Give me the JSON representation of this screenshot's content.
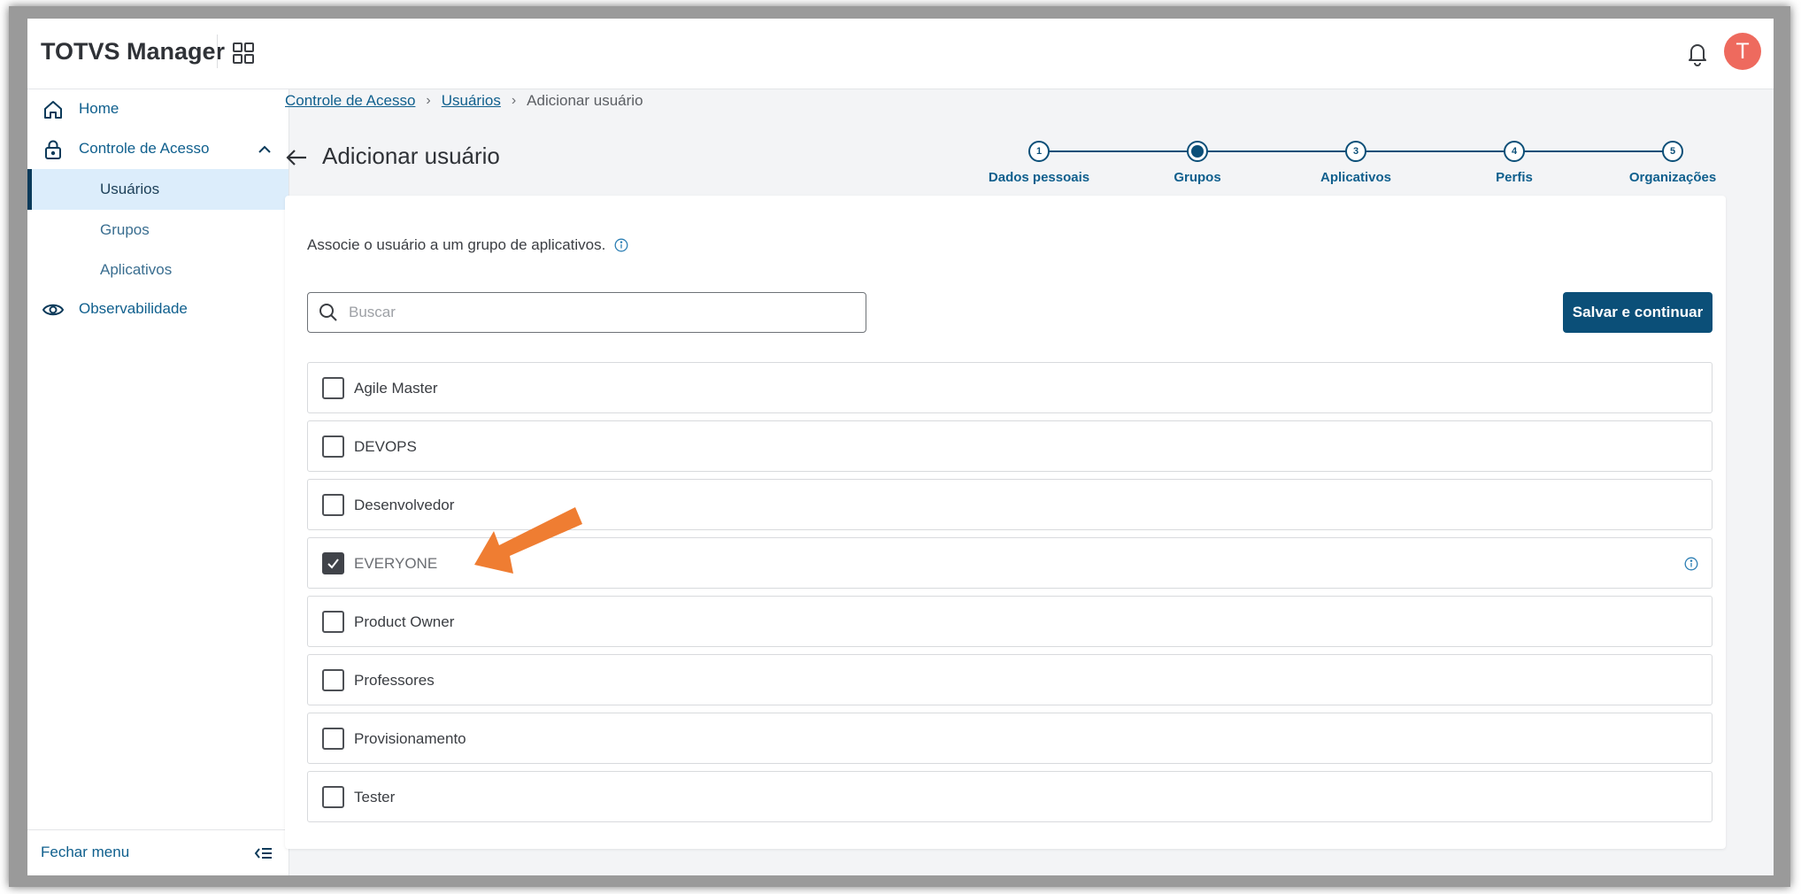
{
  "header": {
    "app_title": "TOTVS Manager",
    "avatar_initial": "T",
    "colors": {
      "avatar_bg": "#ee6a5e",
      "primary": "#0b4f78"
    }
  },
  "sidebar": {
    "items": [
      {
        "label": "Home",
        "icon": "home-icon"
      },
      {
        "label": "Controle de Acesso",
        "icon": "lock-icon",
        "expanded": true,
        "children": [
          {
            "label": "Usuários",
            "active": true
          },
          {
            "label": "Grupos"
          },
          {
            "label": "Aplicativos"
          }
        ]
      },
      {
        "label": "Observabilidade",
        "icon": "eye-icon"
      }
    ],
    "footer_label": "Fechar menu"
  },
  "breadcrumb": {
    "items": [
      "Controle de Acesso",
      "Usuários",
      "Adicionar usuário"
    ]
  },
  "page": {
    "title": "Adicionar usuário"
  },
  "stepper": {
    "current_step": 2,
    "steps": [
      {
        "number": "1",
        "label": "Dados pessoais"
      },
      {
        "number": "2",
        "label": "Grupos"
      },
      {
        "number": "3",
        "label": "Aplicativos"
      },
      {
        "number": "4",
        "label": "Perfis"
      },
      {
        "number": "5",
        "label": "Organizações"
      }
    ]
  },
  "card": {
    "description": "Associe o usuário a um grupo de aplicativos.",
    "search": {
      "placeholder": "Buscar",
      "value": ""
    },
    "save_button": "Salvar e continuar",
    "groups": [
      {
        "name": "Agile Master",
        "checked": false
      },
      {
        "name": "DEVOPS",
        "checked": false
      },
      {
        "name": "Desenvolvedor",
        "checked": false
      },
      {
        "name": "EVERYONE",
        "checked": true,
        "has_info": true
      },
      {
        "name": "Product Owner",
        "checked": false
      },
      {
        "name": "Professores",
        "checked": false
      },
      {
        "name": "Provisionamento",
        "checked": false
      },
      {
        "name": "Tester",
        "checked": false
      }
    ]
  },
  "annotation": {
    "arrow_color": "#ef7d32",
    "points_to": "EVERYONE"
  }
}
